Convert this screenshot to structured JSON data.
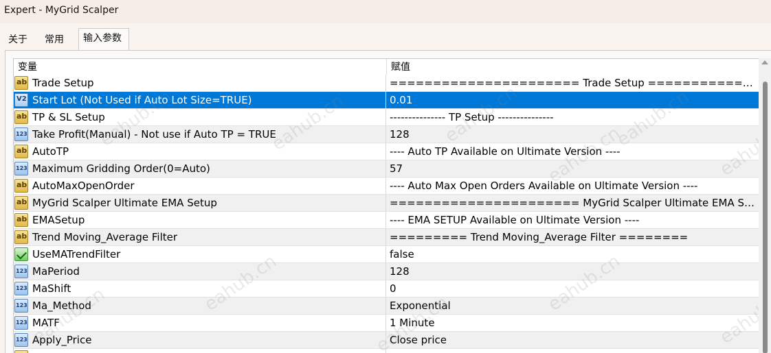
{
  "window": {
    "title": "Expert - MyGrid Scalper"
  },
  "tabs": [
    {
      "label": "关于"
    },
    {
      "label": "常用"
    },
    {
      "label": "输入参数"
    }
  ],
  "table": {
    "columns": [
      "变量",
      "赋值"
    ],
    "rows": [
      {
        "icon": "ab",
        "name": "Trade Setup",
        "value": "====================== Trade Setup ================..."
      },
      {
        "icon": "dbl",
        "name": "Start Lot (Not Used if Auto Lot Size=TRUE)",
        "value": "0.01"
      },
      {
        "icon": "ab",
        "name": "TP & SL Setup",
        "value": "--------------- TP  Setup ---------------"
      },
      {
        "icon": "num",
        "name": "Take Profit(Manual) - Not use if Auto TP = TRUE",
        "value": "128"
      },
      {
        "icon": "ab",
        "name": "AutoTP",
        "value": "---- Auto TP Available on Ultimate Version ----"
      },
      {
        "icon": "num",
        "name": "Maximum Gridding Order(0=Auto)",
        "value": "57"
      },
      {
        "icon": "ab",
        "name": "AutoMaxOpenOrder",
        "value": "---- Auto Max Open Orders Available on Ultimate Version ----"
      },
      {
        "icon": "ab",
        "name": "MyGrid Scalper Ultimate EMA Setup",
        "value": "====================== MyGrid Scalper Ultimate EMA Setup..."
      },
      {
        "icon": "ab",
        "name": "EMASetup",
        "value": "---- EMA SETUP  Available on Ultimate Version ----"
      },
      {
        "icon": "ab",
        "name": "Trend Moving_Average Filter",
        "value": "========= Trend Moving_Average Filter ========"
      },
      {
        "icon": "bool",
        "name": "UseMATrendFilter",
        "value": "false"
      },
      {
        "icon": "num",
        "name": "MaPeriod",
        "value": "128"
      },
      {
        "icon": "num",
        "name": "MaShift",
        "value": "0"
      },
      {
        "icon": "num",
        "name": "Ma_Method",
        "value": "Exponential"
      },
      {
        "icon": "num",
        "name": "MATF",
        "value": "1 Minute"
      },
      {
        "icon": "num",
        "name": "Apply_Price",
        "value": "Close price"
      },
      {
        "icon": "ab",
        "name": "",
        "value": ""
      }
    ],
    "selected_index": 1
  },
  "watermark": "eahub.cn"
}
